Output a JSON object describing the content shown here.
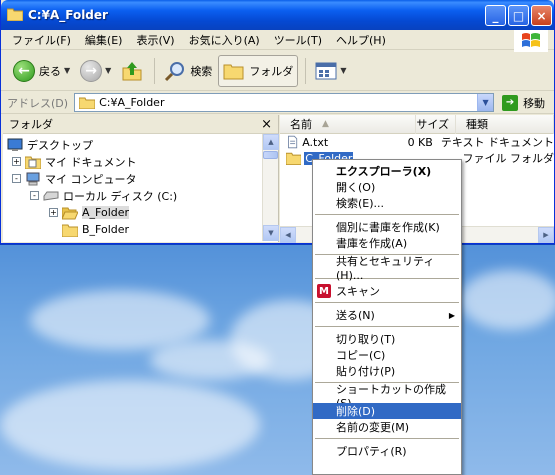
{
  "window": {
    "title": "C:¥A_Folder"
  },
  "menubar": {
    "items": [
      "ファイル(F)",
      "編集(E)",
      "表示(V)",
      "お気に入り(A)",
      "ツール(T)",
      "ヘルプ(H)"
    ]
  },
  "toolbar": {
    "back": "戻る",
    "search": "検索",
    "folders": "フォルダ"
  },
  "address": {
    "label": "アドレス(D)",
    "value": "C:¥A_Folder",
    "go": "移動"
  },
  "folder_pane": {
    "title": "フォルダ",
    "close": "×",
    "tree": [
      {
        "label": "デスクトップ",
        "expander": ""
      },
      {
        "label": "マイ ドキュメント",
        "expander": "+"
      },
      {
        "label": "マイ コンピュータ",
        "expander": "-"
      },
      {
        "label": "ローカル ディスク (C:)",
        "expander": "-"
      },
      {
        "label": "A_Folder",
        "expander": "+"
      },
      {
        "label": "B_Folder",
        "expander": ""
      }
    ]
  },
  "file_pane": {
    "columns": [
      "名前",
      "サイズ",
      "種類"
    ],
    "files": [
      {
        "name": "A.txt",
        "size": "0 KB",
        "type": "テキスト ドキュメント"
      },
      {
        "name": "C_Folder",
        "size": "",
        "type": "ファイル フォルダ"
      }
    ]
  },
  "context_menu": {
    "items": [
      {
        "label": "エクスプローラ(X)"
      },
      {
        "label": "開く(O)"
      },
      {
        "label": "検索(E)..."
      },
      {
        "label": "個別に書庫を作成(K)"
      },
      {
        "label": "書庫を作成(A)"
      },
      {
        "label": "共有とセキュリティ(H)..."
      },
      {
        "label": "スキャン"
      },
      {
        "label": "送る(N)"
      },
      {
        "label": "切り取り(T)"
      },
      {
        "label": "コピー(C)"
      },
      {
        "label": "貼り付け(P)"
      },
      {
        "label": "ショートカットの作成(S)"
      },
      {
        "label": "削除(D)"
      },
      {
        "label": "名前の変更(M)"
      },
      {
        "label": "プロパティ(R)"
      }
    ]
  },
  "colors": {
    "titlebar": "#0b5ff0",
    "menu_highlight": "#316ac5",
    "desktop": "#4a8ad6"
  }
}
